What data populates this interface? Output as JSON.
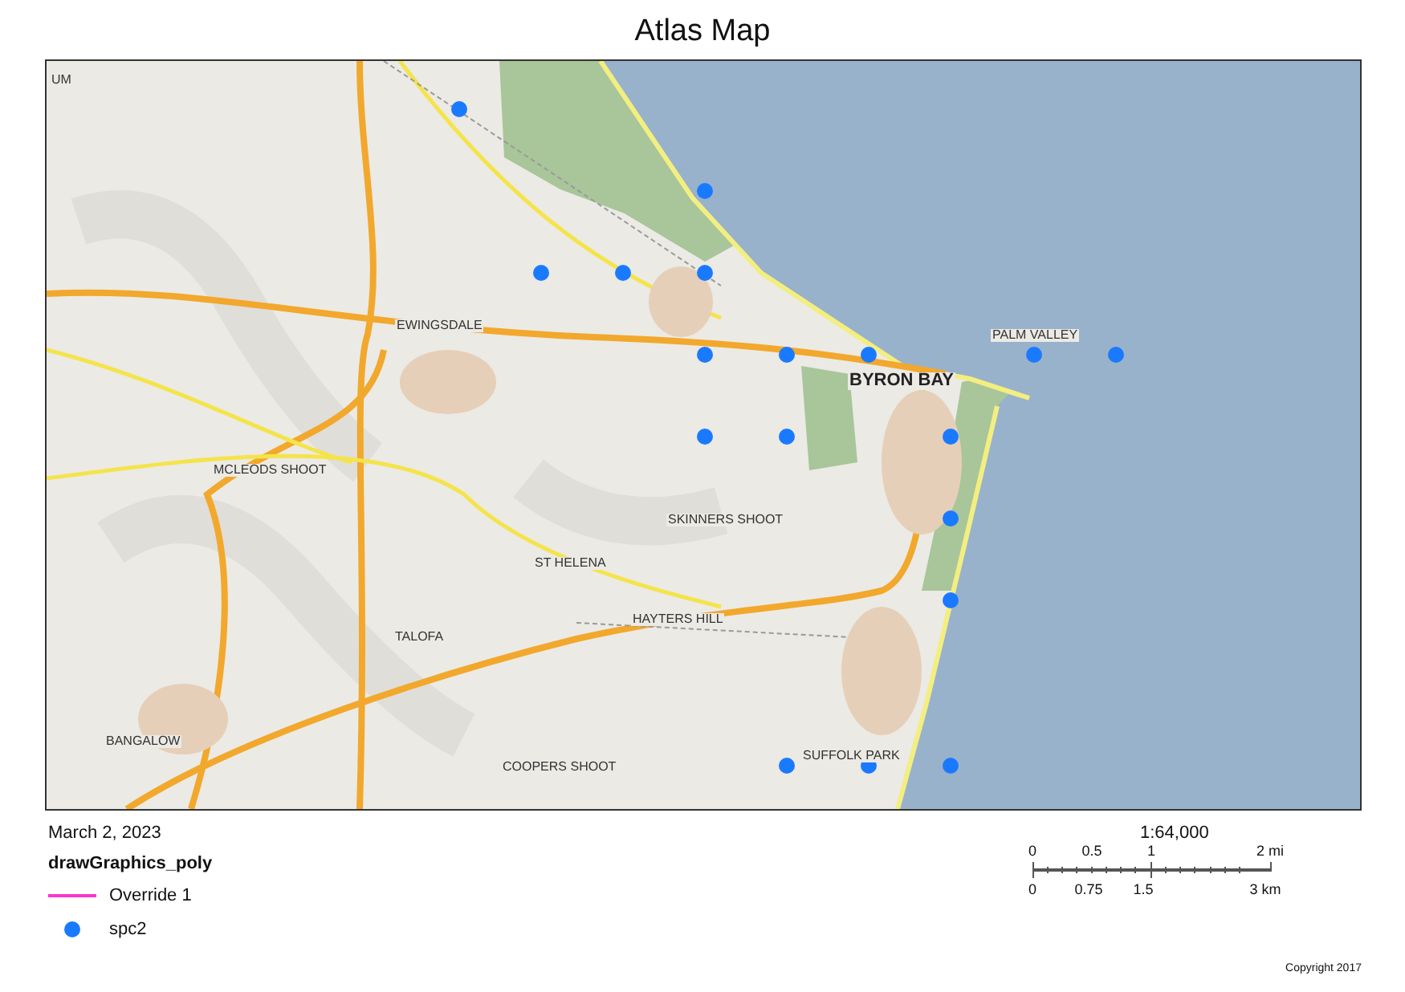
{
  "title": "Atlas Map",
  "map": {
    "labels": [
      {
        "text": "UM",
        "kind": "minor"
      },
      {
        "text": "EWINGSDALE",
        "kind": "minor"
      },
      {
        "text": "BYRON BAY",
        "kind": "major"
      },
      {
        "text": "PALM VALLEY",
        "kind": "minor"
      },
      {
        "text": "MCLEODS SHOOT",
        "kind": "minor"
      },
      {
        "text": "SKINNERS SHOOT",
        "kind": "minor"
      },
      {
        "text": "ST HELENA",
        "kind": "minor"
      },
      {
        "text": "HAYTERS HILL",
        "kind": "minor"
      },
      {
        "text": "TALOFA",
        "kind": "minor"
      },
      {
        "text": "BANGALOW",
        "kind": "minor"
      },
      {
        "text": "COOPERS SHOOT",
        "kind": "minor"
      },
      {
        "text": "SUFFOLK PARK",
        "kind": "minor"
      }
    ]
  },
  "date": "March 2, 2023",
  "legend": {
    "title": "drawGraphics_poly",
    "items": [
      {
        "kind": "line",
        "label": "Override 1",
        "color": "#ff33cc"
      },
      {
        "kind": "point",
        "label": "spc2",
        "color": "#1a7aff"
      }
    ]
  },
  "scale": {
    "ratio": "1:64,000",
    "upper_ticks": [
      "0",
      "0.5",
      "1",
      "2 mi"
    ],
    "lower_ticks": [
      "0",
      "0.75",
      "1.5",
      "3 km"
    ]
  },
  "copyright": "Copyright 2017"
}
